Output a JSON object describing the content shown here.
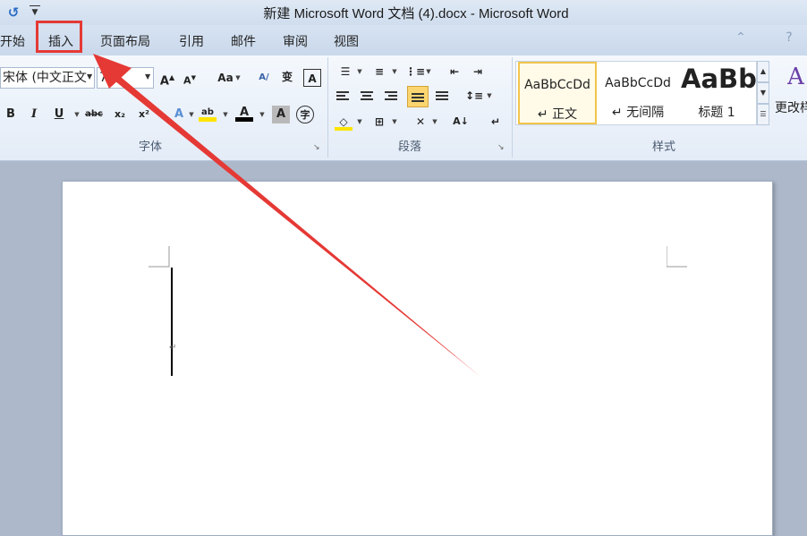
{
  "window": {
    "title": "新建 Microsoft Word 文档 (4).docx - Microsoft Word"
  },
  "quick_access": {
    "undo_icon": "undo-icon",
    "customize_icon": "customize-qat-icon"
  },
  "tabs": [
    {
      "label": "开始"
    },
    {
      "label": "插入",
      "highlighted": true
    },
    {
      "label": "页面布局"
    },
    {
      "label": "引用"
    },
    {
      "label": "邮件"
    },
    {
      "label": "审阅"
    },
    {
      "label": "视图"
    }
  ],
  "ribbon": {
    "font_group": {
      "label": "字体",
      "font_name": "宋体 (中文正文",
      "font_size": "72"
    },
    "paragraph_group": {
      "label": "段落"
    },
    "styles_group": {
      "label": "样式",
      "items": [
        {
          "sample": "AaBbCcDd",
          "name": "↵ 正文",
          "selected": true
        },
        {
          "sample": "AaBbCcDd",
          "name": "↵ 无间隔"
        },
        {
          "sample": "AaBb",
          "name": "标题 1"
        }
      ],
      "change_styles_label": "更改样式"
    }
  },
  "annotation": {
    "highlight_color": "#e53935",
    "arrow_color": "#e53935"
  }
}
